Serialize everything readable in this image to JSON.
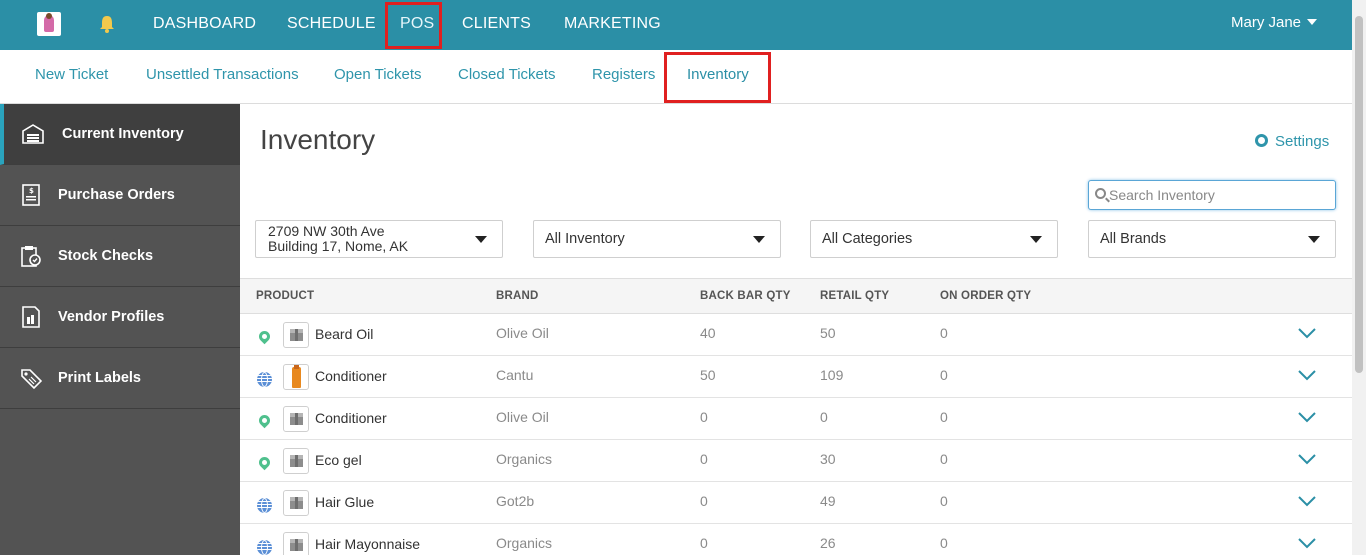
{
  "topnav": {
    "items": [
      "DASHBOARD",
      "SCHEDULE",
      "POS",
      "CLIENTS",
      "MARKETING"
    ],
    "user": "Mary Jane",
    "colors": {
      "bar": "#2b8fa6",
      "highlight": "#e02020"
    }
  },
  "subnav": {
    "items": [
      "New Ticket",
      "Unsettled Transactions",
      "Open Tickets",
      "Closed Tickets",
      "Registers",
      "Inventory"
    ]
  },
  "sidebar": {
    "items": [
      {
        "label": "Current Inventory",
        "icon": "warehouse-icon"
      },
      {
        "label": "Purchase Orders",
        "icon": "receipt-icon"
      },
      {
        "label": "Stock Checks",
        "icon": "clipboard-check-icon"
      },
      {
        "label": "Vendor Profiles",
        "icon": "vendor-building-icon"
      },
      {
        "label": "Print Labels",
        "icon": "tag-icon"
      }
    ]
  },
  "main": {
    "title": "Inventory",
    "settings_label": "Settings",
    "search_placeholder": "Search Inventory",
    "filters": {
      "location_line1": "2709 NW 30th Ave",
      "location_line2": "Building 17, Nome, AK",
      "inventory": "All Inventory",
      "categories": "All Categories",
      "brands": "All Brands"
    }
  },
  "table": {
    "headers": [
      "PRODUCT",
      "BRAND",
      "BACK BAR QTY",
      "RETAIL QTY",
      "ON ORDER QTY"
    ],
    "rows": [
      {
        "location_icon": "pin-icon",
        "image": "box",
        "product": "Beard Oil",
        "brand": "Olive Oil",
        "back_bar": "40",
        "retail": "50",
        "on_order": "0"
      },
      {
        "location_icon": "globe-icon",
        "image": "bottle",
        "product": "Conditioner",
        "brand": "Cantu",
        "back_bar": "50",
        "retail": "109",
        "on_order": "0"
      },
      {
        "location_icon": "pin-icon",
        "image": "box",
        "product": "Conditioner",
        "brand": "Olive Oil",
        "back_bar": "0",
        "retail": "0",
        "on_order": "0"
      },
      {
        "location_icon": "pin-icon",
        "image": "box",
        "product": "Eco gel",
        "brand": "Organics",
        "back_bar": "0",
        "retail": "30",
        "on_order": "0"
      },
      {
        "location_icon": "globe-icon",
        "image": "box",
        "product": "Hair Glue",
        "brand": "Got2b",
        "back_bar": "0",
        "retail": "49",
        "on_order": "0"
      },
      {
        "location_icon": "globe-icon",
        "image": "box",
        "product": "Hair Mayonnaise",
        "brand": "Organics",
        "back_bar": "0",
        "retail": "26",
        "on_order": "0"
      }
    ]
  }
}
